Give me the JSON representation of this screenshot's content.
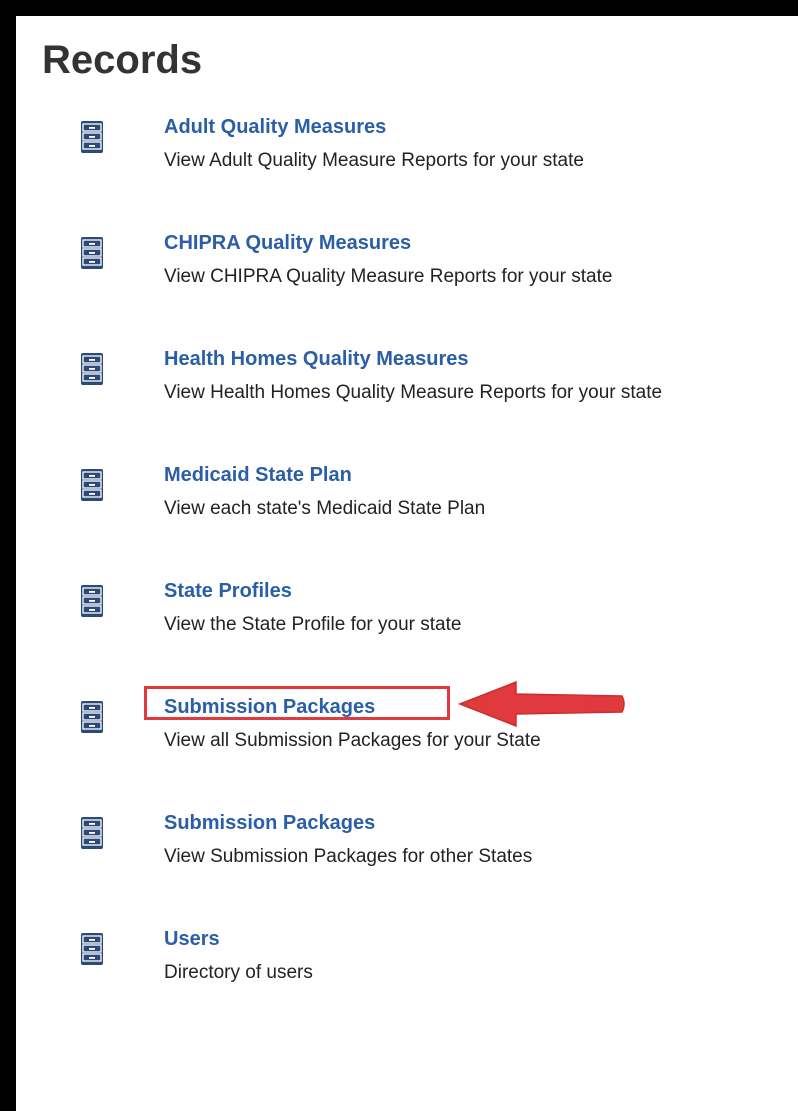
{
  "page": {
    "title": "Records",
    "accent_color": "#2a5ea6",
    "icon": "file-cabinet-icon",
    "annotation_color": "#e0393e"
  },
  "records": [
    {
      "label": "Adult Quality Measures",
      "description": "View Adult Quality Measure Reports for your state"
    },
    {
      "label": "CHIPRA Quality Measures",
      "description": "View CHIPRA Quality Measure Reports for your state"
    },
    {
      "label": "Health Homes Quality Measures",
      "description": "View Health Homes Quality Measure Reports for your state"
    },
    {
      "label": "Medicaid State Plan",
      "description": "View each state's Medicaid State Plan"
    },
    {
      "label": "State Profiles",
      "description": "View the State Profile for your state"
    },
    {
      "label": "Submission Packages",
      "description": "View all Submission Packages for your State"
    },
    {
      "label": "Submission Packages",
      "description": "View Submission Packages for other States"
    },
    {
      "label": "Users",
      "description": "Directory of users"
    }
  ]
}
